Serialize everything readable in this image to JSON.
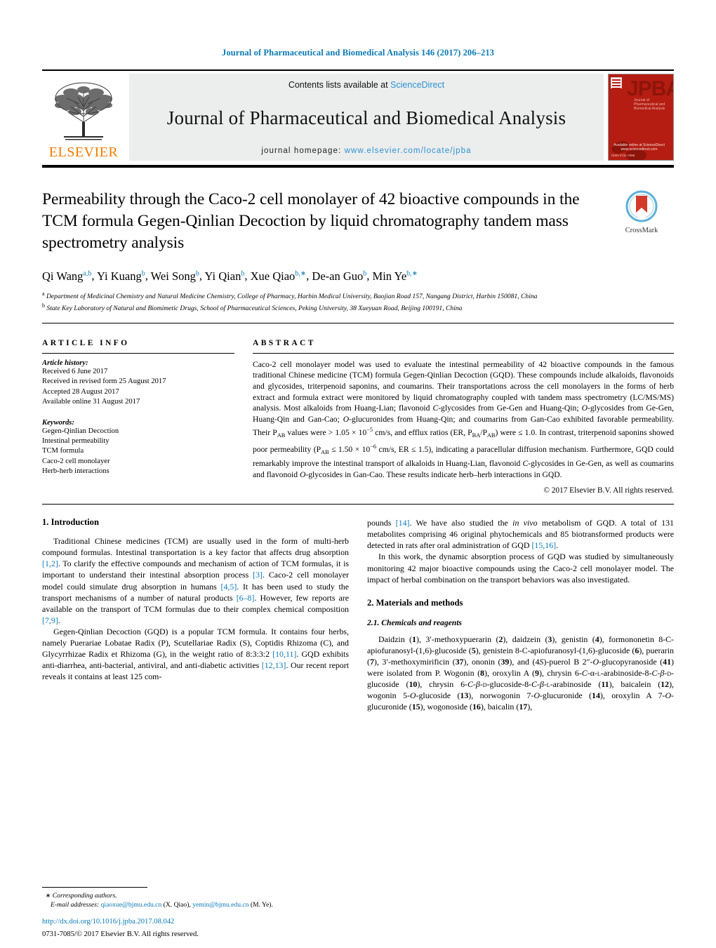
{
  "running_head": "Journal of Pharmaceutical and Biomedical Analysis 146 (2017) 206–213",
  "masthead": {
    "publisher": "ELSEVIER",
    "contents_prefix": "Contents lists available at ",
    "contents_link": "ScienceDirect",
    "journal_name": "Journal of Pharmaceutical and Biomedical Analysis",
    "homepage_prefix": "journal homepage: ",
    "homepage_url": "www.elsevier.com/locate/jpba",
    "cover_title": "JPBA",
    "cover_subtitle": "Journal of Pharmaceutical and Biomedical Analysis",
    "cover_footer": "ISSN 0731-7085",
    "cover_elsevier": "Available online at ScienceDirect www.sciencedirect.com",
    "accent_blue": "#2b93d1",
    "elsevier_orange": "#f07c00",
    "cover_red": "#b51d12"
  },
  "crossmark": {
    "label": "CrossMark"
  },
  "title": "Permeability through the Caco-2 cell monolayer of 42 bioactive compounds in the TCM formula Gegen-Qinlian Decoction by liquid chromatography tandem mass spectrometry analysis",
  "authors": [
    {
      "name": "Qi Wang",
      "marks": "a,b"
    },
    {
      "name": "Yi Kuang",
      "marks": "b"
    },
    {
      "name": "Wei Song",
      "marks": "b"
    },
    {
      "name": "Yi Qian",
      "marks": "b"
    },
    {
      "name": "Xue Qiao",
      "marks": "b,∗"
    },
    {
      "name": "De-an Guo",
      "marks": "b"
    },
    {
      "name": "Min Ye",
      "marks": "b,∗"
    }
  ],
  "affiliations": [
    {
      "mark": "a",
      "text": "Department of Medicinal Chemistry and Natural Medicine Chemistry, College of Pharmacy, Harbin Medical University, Baojian Road 157, Nangang District, Harbin 150081, China"
    },
    {
      "mark": "b",
      "text": "State Key Laboratory of Natural and Biomimetic Drugs, School of Pharmaceutical Sciences, Peking University, 38 Xueyuan Road, Beijing 100191, China"
    }
  ],
  "article_info": {
    "heading": "ARTICLE INFO",
    "history_title": "Article history:",
    "history": [
      "Received 6 June 2017",
      "Received in revised form 25 August 2017",
      "Accepted 28 August 2017",
      "Available online 31 August 2017"
    ],
    "keywords_title": "Keywords:",
    "keywords": [
      "Gegen-Qinlian Decoction",
      "Intestinal permeability",
      "TCM formula",
      "Caco-2 cell monolayer",
      "Herb-herb interactions"
    ]
  },
  "abstract": {
    "heading": "ABSTRACT",
    "copyright": "© 2017 Elsevier B.V. All rights reserved."
  },
  "sections": {
    "intro_heading": "1.  Introduction",
    "methods_heading": "2.  Materials and methods",
    "chem_heading": "2.1.  Chemicals and reagents"
  },
  "footnotes": {
    "corresponding": "Corresponding authors.",
    "email_label": "E-mail addresses:",
    "email1": "qiaoxue@bjmu.edu.cn",
    "email1_who": "(X. Qiao),",
    "email2": "yemin@bjmu.edu.cn",
    "email2_who": "(M. Ye).",
    "doi": "http://dx.doi.org/10.1016/j.jpba.2017.08.042",
    "issn": "0731-7085/© 2017 Elsevier B.V. All rights reserved."
  }
}
